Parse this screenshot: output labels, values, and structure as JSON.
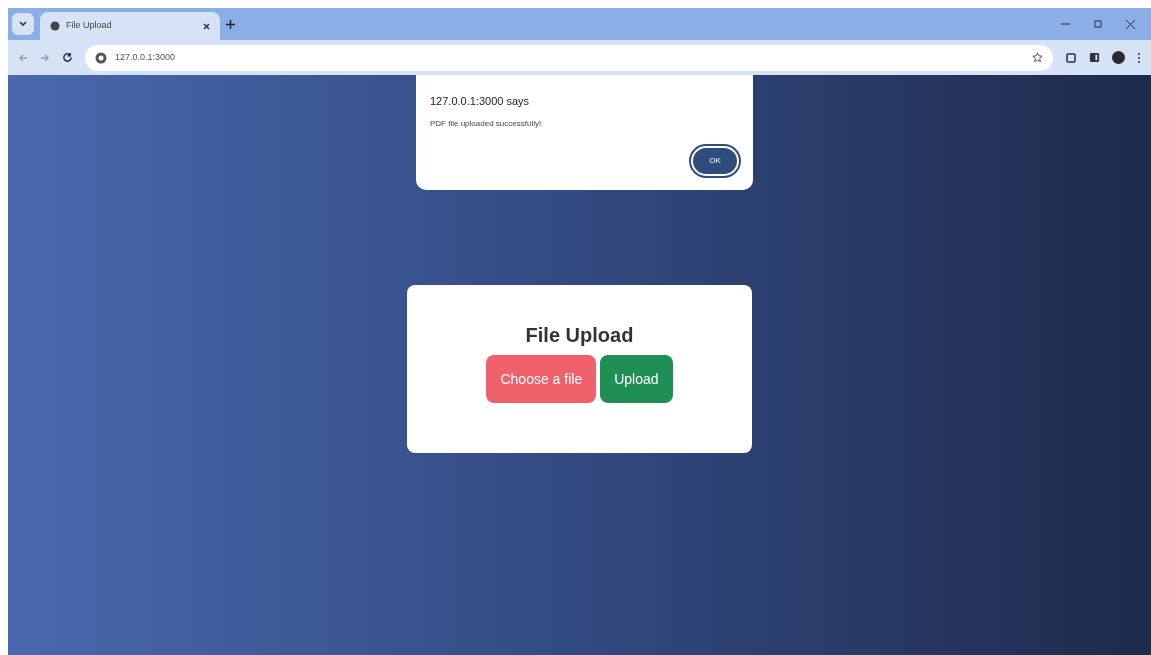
{
  "browser": {
    "tabs": [
      {
        "title": "File Upload",
        "selected": true
      }
    ],
    "address": "127.0.0.1:3000"
  },
  "dialog": {
    "title": "127.0.0.1:3000 says",
    "message": "PDF file uploaded successfully!",
    "button": "OK"
  },
  "card": {
    "heading": "File Upload",
    "buttons": [
      {
        "label": "Choose a file",
        "kind": "file"
      },
      {
        "label": "Upload",
        "kind": "submit"
      }
    ]
  }
}
